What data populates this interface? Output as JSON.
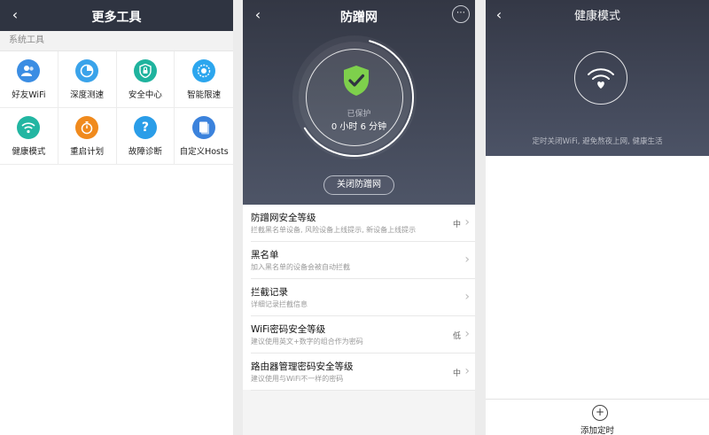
{
  "more_tools": {
    "title": "更多工具",
    "section": "系统工具",
    "tools": [
      {
        "label": "好友WiFi",
        "icon": "people-icon",
        "color": "#3b8de3"
      },
      {
        "label": "深度测速",
        "icon": "speed-pie-icon",
        "color": "#3aa3ea"
      },
      {
        "label": "安全中心",
        "icon": "shield-lock-icon",
        "color": "#1fb39e"
      },
      {
        "label": "智能限速",
        "icon": "limit-dial-icon",
        "color": "#2ca6ee"
      },
      {
        "label": "健康模式",
        "icon": "wifi-icon",
        "color": "#22b6a2"
      },
      {
        "label": "重启计划",
        "icon": "timer-icon",
        "color": "#f08a1d"
      },
      {
        "label": "故障诊断",
        "icon": "question-icon",
        "color": "#2a9de8"
      },
      {
        "label": "自定义Hosts",
        "icon": "document-icon",
        "color": "#3b82dc"
      }
    ]
  },
  "anti_freeload": {
    "title": "防蹭网",
    "status": "已保护",
    "duration": "0 小时 6 分钟",
    "protection_progress": 0.62,
    "close_button": "关闭防蹭网",
    "settings": [
      {
        "title": "防蹭网安全等级",
        "subtitle": "拦截黑名单设备, 风险设备上线提示, 新设备上线提示",
        "value": "中"
      },
      {
        "title": "黑名单",
        "subtitle": "加入黑名单的设备会被自动拦截",
        "value": ""
      },
      {
        "title": "拦截记录",
        "subtitle": "详细记录拦截信息",
        "value": ""
      },
      {
        "title": "WiFi密码安全等级",
        "subtitle": "建议使用英文+数字的组合作为密码",
        "value": "低"
      },
      {
        "title": "路由器管理密码安全等级",
        "subtitle": "建议使用与WiFi不一样的密码",
        "value": "中"
      }
    ]
  },
  "health_mode": {
    "title": "健康模式",
    "caption": "定时关闭WiFi, 避免熬夜上网, 健康生活",
    "add_button": "+",
    "add_label": "添加定时"
  },
  "colors": {
    "header_dark": "#2f3441",
    "shield_green": "#7ed04c"
  }
}
